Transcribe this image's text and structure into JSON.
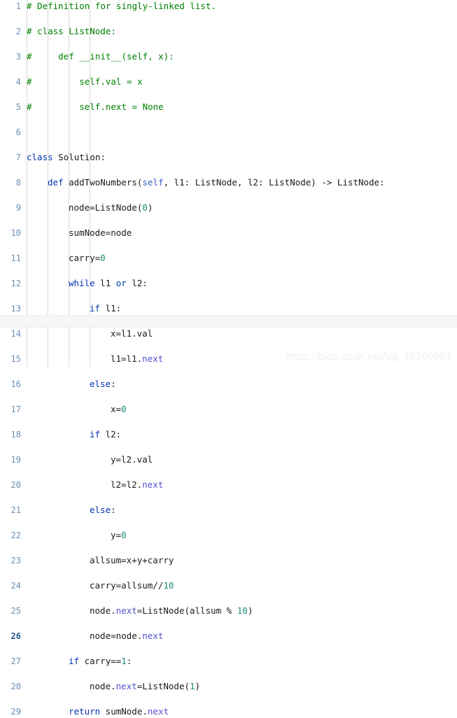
{
  "editor": {
    "language": "Python",
    "background_color": "#ffffff",
    "gutter_color": "#6a8fb5",
    "active_line": 26,
    "line_height_px": 18,
    "first_visible_line": 1,
    "last_visible_line": 29,
    "indent_guide_x": [
      38,
      68,
      98,
      128
    ],
    "colors": {
      "comment": "#008000",
      "keyword": "#0033b3",
      "self": "#3a5fcd",
      "number": "#1a8a7a",
      "attribute": "#5050d0",
      "plain": "#1a1a1a",
      "current_line": "#f7f7f7"
    }
  },
  "watermark": {
    "text": "https://blog.csdn.net/qq_40160983"
  },
  "lines": [
    {
      "n": "1",
      "indent": 0,
      "tokens": [
        {
          "t": "cm",
          "s": "# Definition for singly-linked list."
        }
      ]
    },
    {
      "n": "2",
      "indent": 0,
      "tokens": [
        {
          "t": "cm",
          "s": "# class ListNode:"
        }
      ]
    },
    {
      "n": "3",
      "indent": 0,
      "tokens": [
        {
          "t": "cm",
          "s": "#     def __init__(self, x):"
        }
      ]
    },
    {
      "n": "4",
      "indent": 0,
      "tokens": [
        {
          "t": "cm",
          "s": "#         self.val = x"
        }
      ]
    },
    {
      "n": "5",
      "indent": 0,
      "tokens": [
        {
          "t": "cm",
          "s": "#         self.next = None"
        }
      ]
    },
    {
      "n": "6",
      "indent": 0,
      "tokens": []
    },
    {
      "n": "7",
      "indent": 0,
      "tokens": [
        {
          "t": "kw",
          "s": "class"
        },
        {
          "t": "pl",
          "s": " Solution:"
        }
      ]
    },
    {
      "n": "8",
      "indent": 1,
      "tokens": [
        {
          "t": "kw",
          "s": "def"
        },
        {
          "t": "pl",
          "s": " addTwoNumbers("
        },
        {
          "t": "slf",
          "s": "self"
        },
        {
          "t": "pl",
          "s": ", l1: ListNode, l2: ListNode) -> ListNode:"
        }
      ]
    },
    {
      "n": "9",
      "indent": 2,
      "tokens": [
        {
          "t": "pl",
          "s": "node=ListNode("
        },
        {
          "t": "num",
          "s": "0"
        },
        {
          "t": "pl",
          "s": ")"
        }
      ]
    },
    {
      "n": "10",
      "indent": 2,
      "tokens": [
        {
          "t": "pl",
          "s": "sumNode=node"
        }
      ]
    },
    {
      "n": "11",
      "indent": 2,
      "tokens": [
        {
          "t": "pl",
          "s": "carry="
        },
        {
          "t": "num",
          "s": "0"
        }
      ]
    },
    {
      "n": "12",
      "indent": 2,
      "tokens": [
        {
          "t": "kw",
          "s": "while"
        },
        {
          "t": "pl",
          "s": " l1 "
        },
        {
          "t": "kw",
          "s": "or"
        },
        {
          "t": "pl",
          "s": " l2:"
        }
      ]
    },
    {
      "n": "13",
      "indent": 3,
      "tokens": [
        {
          "t": "kw",
          "s": "if"
        },
        {
          "t": "pl",
          "s": " l1:"
        }
      ]
    },
    {
      "n": "14",
      "indent": 4,
      "tokens": [
        {
          "t": "pl",
          "s": "x=l1.val"
        }
      ]
    },
    {
      "n": "15",
      "indent": 4,
      "tokens": [
        {
          "t": "pl",
          "s": "l1=l1."
        },
        {
          "t": "attr",
          "s": "next"
        }
      ]
    },
    {
      "n": "16",
      "indent": 3,
      "tokens": [
        {
          "t": "kw",
          "s": "else"
        },
        {
          "t": "pl",
          "s": ":"
        }
      ]
    },
    {
      "n": "17",
      "indent": 4,
      "tokens": [
        {
          "t": "pl",
          "s": "x="
        },
        {
          "t": "num",
          "s": "0"
        }
      ]
    },
    {
      "n": "18",
      "indent": 3,
      "tokens": [
        {
          "t": "kw",
          "s": "if"
        },
        {
          "t": "pl",
          "s": " l2:"
        }
      ]
    },
    {
      "n": "19",
      "indent": 4,
      "tokens": [
        {
          "t": "pl",
          "s": "y=l2.val"
        }
      ]
    },
    {
      "n": "20",
      "indent": 4,
      "tokens": [
        {
          "t": "pl",
          "s": "l2=l2."
        },
        {
          "t": "attr",
          "s": "next"
        }
      ]
    },
    {
      "n": "21",
      "indent": 3,
      "tokens": [
        {
          "t": "kw",
          "s": "else"
        },
        {
          "t": "pl",
          "s": ":"
        }
      ]
    },
    {
      "n": "22",
      "indent": 4,
      "tokens": [
        {
          "t": "pl",
          "s": "y="
        },
        {
          "t": "num",
          "s": "0"
        }
      ]
    },
    {
      "n": "23",
      "indent": 3,
      "tokens": [
        {
          "t": "pl",
          "s": "allsum=x+y+carry"
        }
      ]
    },
    {
      "n": "24",
      "indent": 3,
      "tokens": [
        {
          "t": "pl",
          "s": "carry=allsum//"
        },
        {
          "t": "num",
          "s": "10"
        }
      ]
    },
    {
      "n": "25",
      "indent": 3,
      "tokens": [
        {
          "t": "pl",
          "s": "node."
        },
        {
          "t": "attr",
          "s": "next"
        },
        {
          "t": "pl",
          "s": "=ListNode(allsum % "
        },
        {
          "t": "num",
          "s": "10"
        },
        {
          "t": "pl",
          "s": ")"
        }
      ]
    },
    {
      "n": "26",
      "indent": 3,
      "tokens": [
        {
          "t": "pl",
          "s": "node=node."
        },
        {
          "t": "attr",
          "s": "next"
        }
      ]
    },
    {
      "n": "27",
      "indent": 2,
      "tokens": [
        {
          "t": "kw",
          "s": "if"
        },
        {
          "t": "pl",
          "s": " carry=="
        },
        {
          "t": "num",
          "s": "1"
        },
        {
          "t": "pl",
          "s": ":"
        }
      ]
    },
    {
      "n": "28",
      "indent": 3,
      "tokens": [
        {
          "t": "pl",
          "s": "node."
        },
        {
          "t": "attr",
          "s": "next"
        },
        {
          "t": "pl",
          "s": "=ListNode("
        },
        {
          "t": "num",
          "s": "1"
        },
        {
          "t": "pl",
          "s": ")"
        }
      ]
    },
    {
      "n": "29",
      "indent": 2,
      "tokens": [
        {
          "t": "kw",
          "s": "return"
        },
        {
          "t": "pl",
          "s": " sumNode."
        },
        {
          "t": "attr",
          "s": "next"
        }
      ]
    }
  ]
}
